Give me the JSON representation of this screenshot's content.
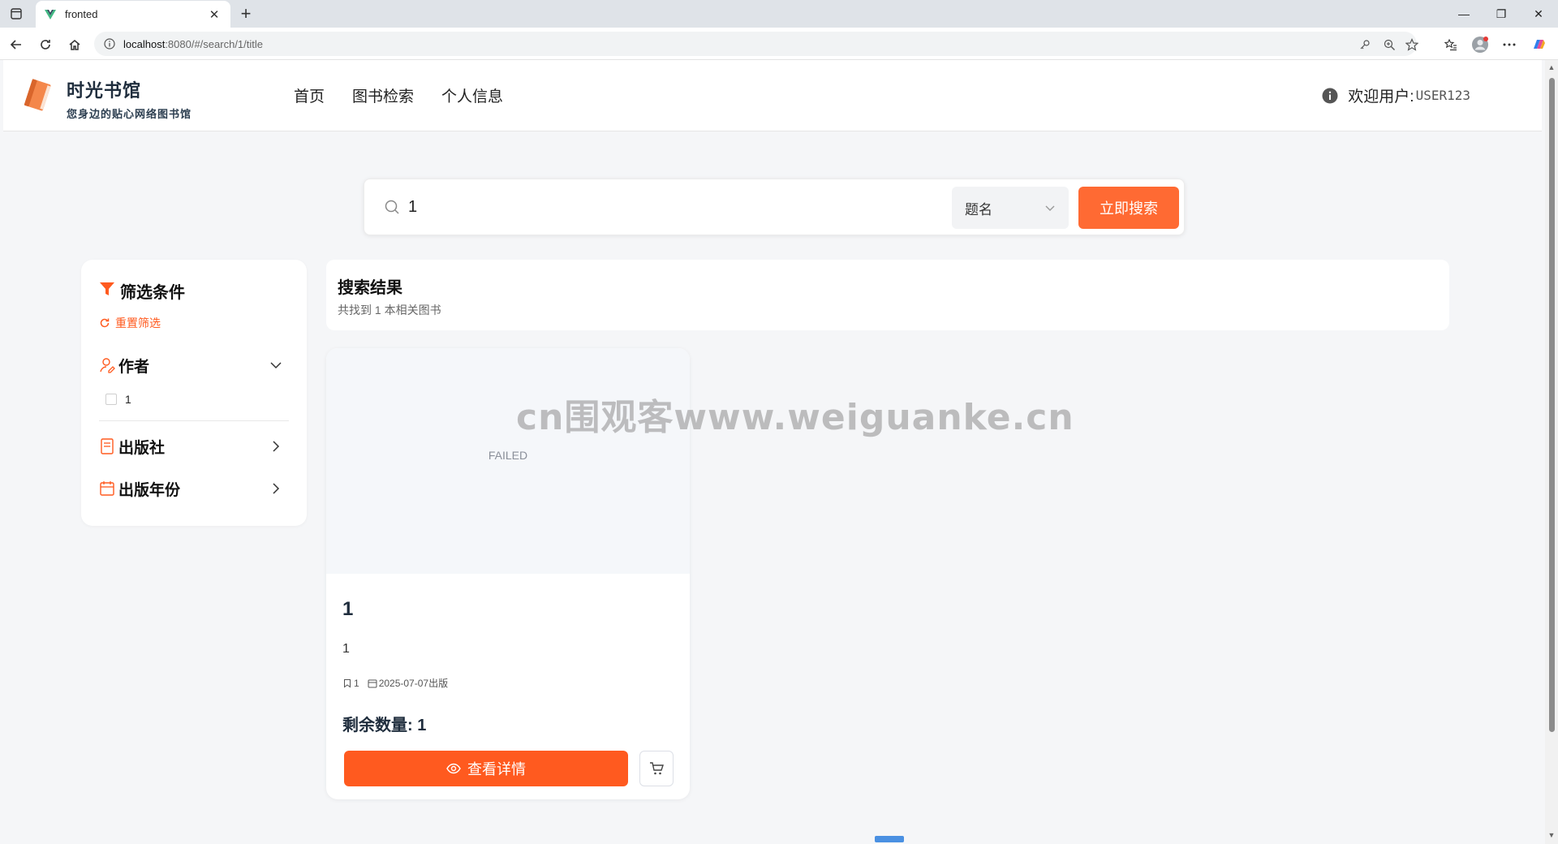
{
  "browser": {
    "tab_title": "fronted",
    "url_host": "localhost",
    "url_rest": ":8080/#/search/1/title"
  },
  "site": {
    "brand_title": "时光书馆",
    "brand_subtitle": "您身边的贴心网络图书馆",
    "nav": [
      "首页",
      "图书检索",
      "个人信息"
    ],
    "welcome_label": "欢迎用户:",
    "username": "USER123"
  },
  "search": {
    "query": "1",
    "field": "题名",
    "button": "立即搜索"
  },
  "filters": {
    "title": "筛选条件",
    "reset": "重置筛选",
    "groups": [
      {
        "label": "作者",
        "expanded": true,
        "options": [
          "1"
        ]
      },
      {
        "label": "出版社",
        "expanded": false
      },
      {
        "label": "出版年份",
        "expanded": false
      }
    ]
  },
  "results": {
    "title": "搜索结果",
    "count_text": "共找到 1 本相关图书"
  },
  "books": [
    {
      "cover_text": "FAILED",
      "title": "1",
      "author": "1",
      "meta_tag": "1",
      "meta_date": "2025-07-07出版",
      "stock": "剩余数量: 1",
      "detail_button": "查看详情"
    }
  ],
  "watermark": "cn围观客www.weiguanke.cn",
  "colors": {
    "accent": "#ff5a1f",
    "search_button": "#ff6a33",
    "page_bg": "#f5f6f8"
  }
}
